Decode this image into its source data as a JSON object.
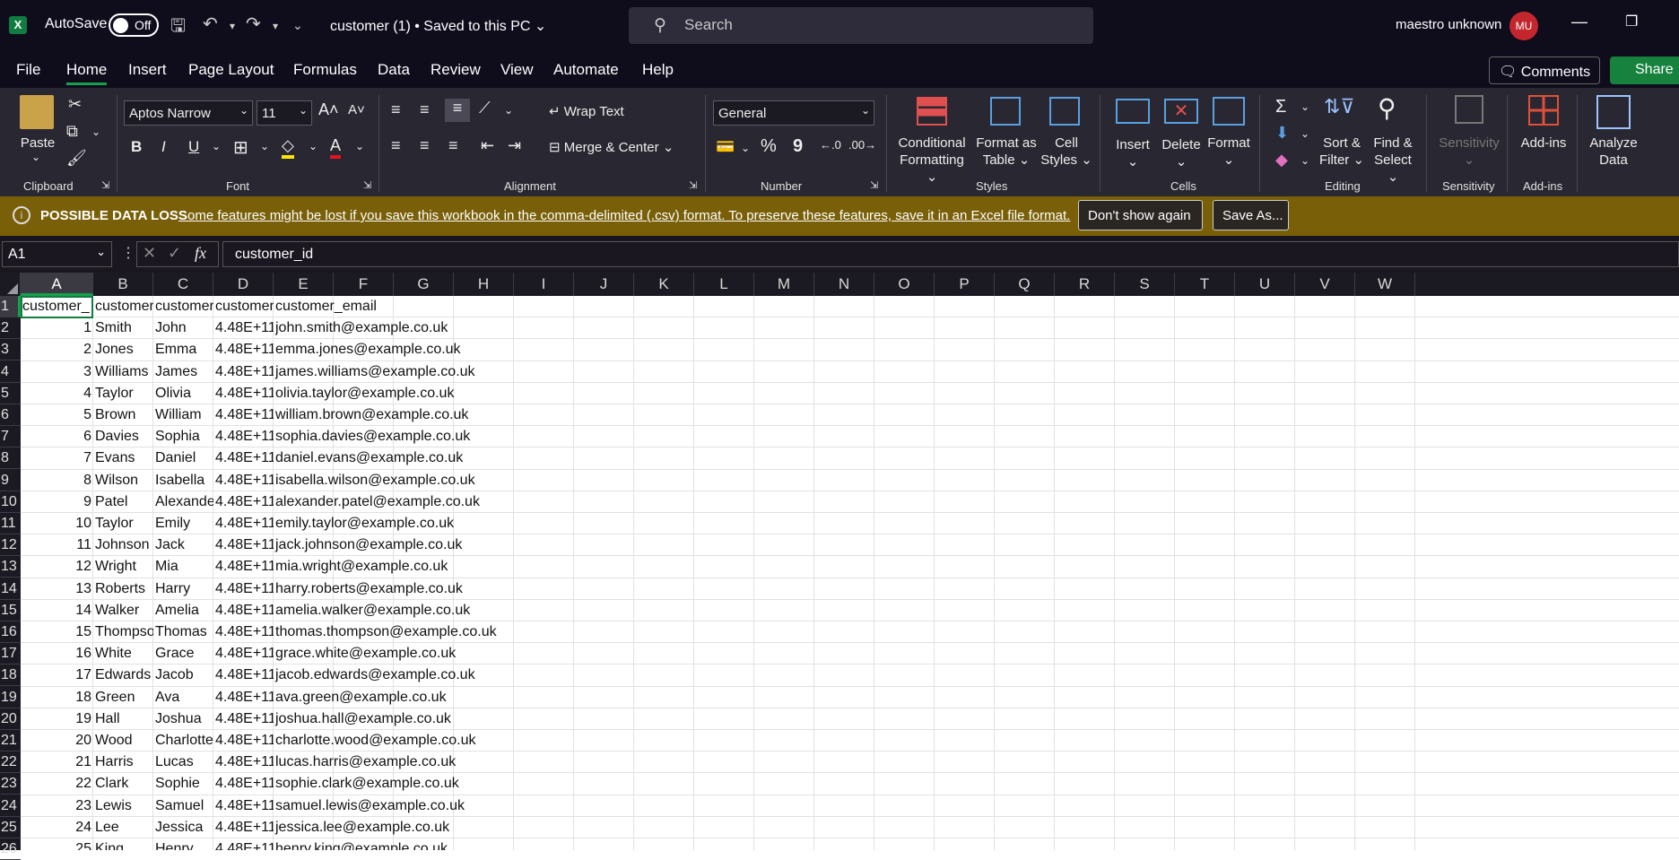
{
  "app": {
    "logo": "X",
    "autosave_label": "AutoSave",
    "toggle_state": "Off",
    "doc_title": "customer (1) • Saved to this PC",
    "search_placeholder": "Search",
    "user_name": "maestro unknown",
    "user_initials": "MU"
  },
  "menu": {
    "items": [
      "File",
      "Home",
      "Insert",
      "Page Layout",
      "Formulas",
      "Data",
      "Review",
      "View",
      "Automate",
      "Help"
    ],
    "active": "Home",
    "comments": "Comments",
    "share": "Share"
  },
  "ribbon": {
    "clipboard": {
      "label": "Clipboard",
      "paste": "Paste"
    },
    "font": {
      "label": "Font",
      "family": "Aptos Narrow",
      "size": "11"
    },
    "alignment": {
      "label": "Alignment",
      "wrap": "Wrap Text",
      "merge": "Merge & Center"
    },
    "number": {
      "label": "Number",
      "format": "General"
    },
    "styles": {
      "label": "Styles",
      "cond_a": "Conditional",
      "cond_b": "Formatting",
      "fat_a": "Format as",
      "fat_b": "Table",
      "cell_a": "Cell",
      "cell_b": "Styles"
    },
    "cells": {
      "label": "Cells",
      "insert": "Insert",
      "delete": "Delete",
      "format": "Format"
    },
    "editing": {
      "label": "Editing",
      "sort_a": "Sort &",
      "sort_b": "Filter",
      "find_a": "Find &",
      "find_b": "Select"
    },
    "sensitivity": {
      "label": "Sensitivity",
      "btn": "Sensitivity"
    },
    "addins": {
      "label": "Add-ins",
      "btn": "Add-ins"
    },
    "analyze": {
      "a": "Analyze",
      "b": "Data"
    }
  },
  "warning": {
    "title": "POSSIBLE DATA LOSS",
    "message": "Some features might be lost if you save this workbook in the comma-delimited (.csv) format. To preserve these features, save it in an Excel file format.",
    "dont_show": "Don't show again",
    "save_as": "Save As..."
  },
  "formula_bar": {
    "cell_ref": "A1",
    "fx": "fx",
    "value": "customer_id"
  },
  "columns": [
    "A",
    "B",
    "C",
    "D",
    "E",
    "F",
    "G",
    "H",
    "I",
    "J",
    "K",
    "L",
    "M",
    "N",
    "O",
    "P",
    "Q",
    "R",
    "S",
    "T",
    "U",
    "V",
    "W"
  ],
  "header_row": [
    "customer_",
    "customer_",
    "customer_",
    "customer_",
    "customer_email"
  ],
  "rows": [
    [
      "1",
      "Smith",
      "John",
      "4.48E+11",
      "john.smith@example.co.uk"
    ],
    [
      "2",
      "Jones",
      "Emma",
      "4.48E+11",
      "emma.jones@example.co.uk"
    ],
    [
      "3",
      "Williams",
      "James",
      "4.48E+11",
      "james.williams@example.co.uk"
    ],
    [
      "4",
      "Taylor",
      "Olivia",
      "4.48E+11",
      "olivia.taylor@example.co.uk"
    ],
    [
      "5",
      "Brown",
      "William",
      "4.48E+11",
      "william.brown@example.co.uk"
    ],
    [
      "6",
      "Davies",
      "Sophia",
      "4.48E+11",
      "sophia.davies@example.co.uk"
    ],
    [
      "7",
      "Evans",
      "Daniel",
      "4.48E+11",
      "daniel.evans@example.co.uk"
    ],
    [
      "8",
      "Wilson",
      "Isabella",
      "4.48E+11",
      "isabella.wilson@example.co.uk"
    ],
    [
      "9",
      "Patel",
      "Alexander",
      "4.48E+11",
      "alexander.patel@example.co.uk"
    ],
    [
      "10",
      "Taylor",
      "Emily",
      "4.48E+11",
      "emily.taylor@example.co.uk"
    ],
    [
      "11",
      "Johnson",
      "Jack",
      "4.48E+11",
      "jack.johnson@example.co.uk"
    ],
    [
      "12",
      "Wright",
      "Mia",
      "4.48E+11",
      "mia.wright@example.co.uk"
    ],
    [
      "13",
      "Roberts",
      "Harry",
      "4.48E+11",
      "harry.roberts@example.co.uk"
    ],
    [
      "14",
      "Walker",
      "Amelia",
      "4.48E+11",
      "amelia.walker@example.co.uk"
    ],
    [
      "15",
      "Thompson",
      "Thomas",
      "4.48E+11",
      "thomas.thompson@example.co.uk"
    ],
    [
      "16",
      "White",
      "Grace",
      "4.48E+11",
      "grace.white@example.co.uk"
    ],
    [
      "17",
      "Edwards",
      "Jacob",
      "4.48E+11",
      "jacob.edwards@example.co.uk"
    ],
    [
      "18",
      "Green",
      "Ava",
      "4.48E+11",
      "ava.green@example.co.uk"
    ],
    [
      "19",
      "Hall",
      "Joshua",
      "4.48E+11",
      "joshua.hall@example.co.uk"
    ],
    [
      "20",
      "Wood",
      "Charlotte",
      "4.48E+11",
      "charlotte.wood@example.co.uk"
    ],
    [
      "21",
      "Harris",
      "Lucas",
      "4.48E+11",
      "lucas.harris@example.co.uk"
    ],
    [
      "22",
      "Clark",
      "Sophie",
      "4.48E+11",
      "sophie.clark@example.co.uk"
    ],
    [
      "23",
      "Lewis",
      "Samuel",
      "4.48E+11",
      "samuel.lewis@example.co.uk"
    ],
    [
      "24",
      "Lee",
      "Jessica",
      "4.48E+11",
      "jessica.lee@example.co.uk"
    ],
    [
      "25",
      "King",
      "Henry",
      "4.48E+11",
      "henry.king@example.co.uk"
    ]
  ]
}
